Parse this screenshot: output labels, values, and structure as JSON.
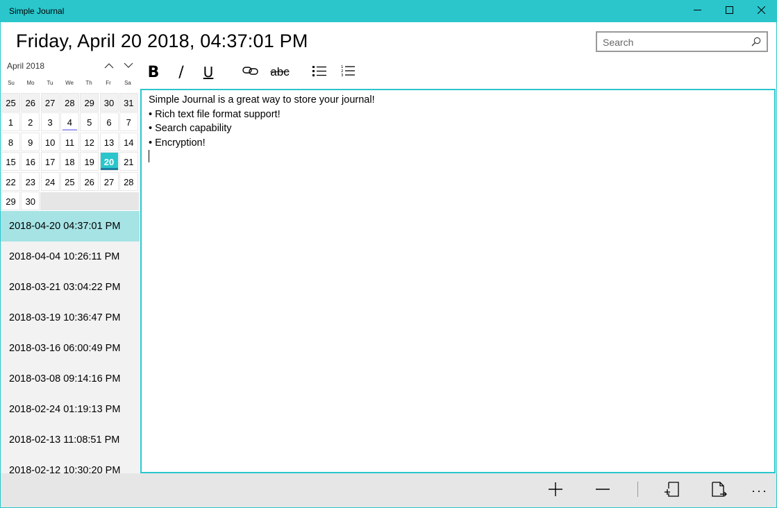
{
  "window": {
    "title": "Simple Journal",
    "accent_color": "#2ac6cc"
  },
  "header": {
    "date_heading": "Friday, April 20 2018, 04:37:01 PM",
    "search": {
      "placeholder": "Search",
      "value": ""
    }
  },
  "calendar": {
    "month_label": "April 2018",
    "weekdays": [
      "Su",
      "Mo",
      "Tu",
      "We",
      "Th",
      "Fr",
      "Sa"
    ],
    "days": [
      "25",
      "26",
      "27",
      "28",
      "29",
      "30",
      "31",
      "1",
      "2",
      "3",
      "4",
      "5",
      "6",
      "7",
      "8",
      "9",
      "10",
      "11",
      "12",
      "13",
      "14",
      "15",
      "16",
      "17",
      "18",
      "19",
      "20",
      "21",
      "22",
      "23",
      "24",
      "25",
      "26",
      "27",
      "28",
      "29",
      "30"
    ],
    "selected_day": "20",
    "today_marker_day": "4"
  },
  "entries": [
    "2018-04-20 04:37:01 PM",
    "2018-04-04 10:26:11 PM",
    "2018-03-21 03:04:22 PM",
    "2018-03-19 10:36:47 PM",
    "2018-03-16 06:00:49 PM",
    "2018-03-08 09:14:16 PM",
    "2018-02-24 01:19:13 PM",
    "2018-02-13 11:08:51 PM",
    "2018-02-12 10:30:20 PM"
  ],
  "selected_entry": "2018-04-20 04:37:01 PM",
  "toolbar": {
    "bold_label": "B",
    "italic_label": "/",
    "underline_label": "U",
    "link_icon": "link-icon",
    "strikethrough_label": "abc",
    "bullets_icon": "bulleted-list-icon",
    "numbered_icon": "numbered-list-icon"
  },
  "editor": {
    "lines": [
      "Simple Journal is a great way to store your journal!",
      "",
      "• Rich text file format support!",
      "• Search capability",
      "• Encryption!"
    ]
  },
  "commandbar": {
    "add_icon": "add-icon",
    "remove_icon": "remove-icon",
    "import_icon": "import-icon",
    "export_icon": "export-icon",
    "more_label": "···"
  }
}
